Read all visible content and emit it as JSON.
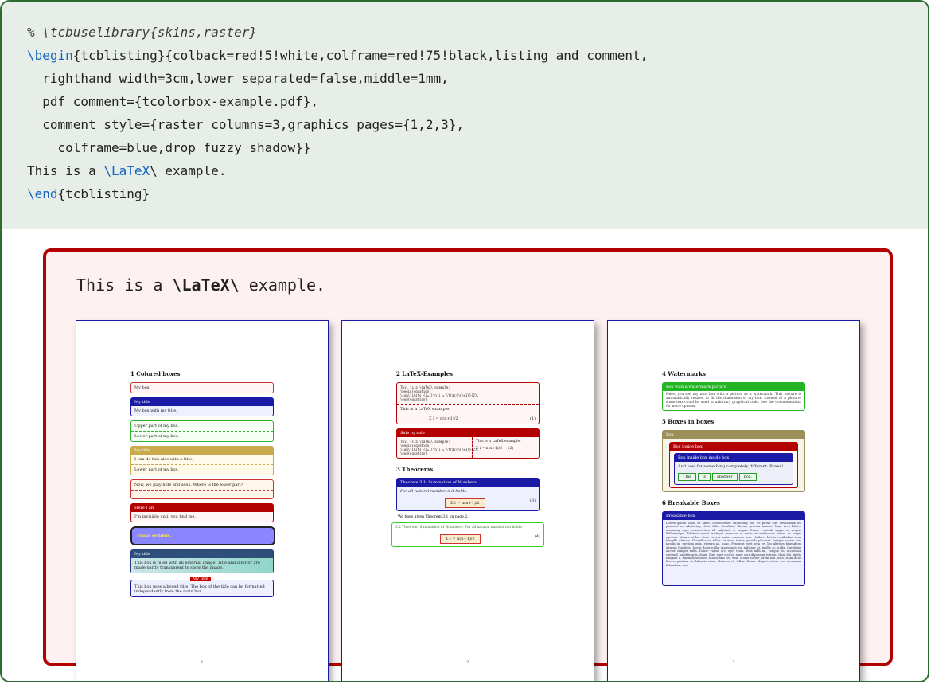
{
  "listing": {
    "lines": [
      "% \\tcbuselibrary{skins,raster}",
      "\\begin{tcblisting}{colback=red!5!white,colframe=red!75!black,listing and comment,",
      "  righthand width=3cm,lower separated=false,middle=1mm,",
      "  pdf comment={tcolorbox-example.pdf},",
      "  comment style={raster columns=3,graphics pages={1,2,3},",
      "    colframe=blue,drop fuzzy shadow}}",
      "This is a \\LaTeX\\ example.",
      "\\end{tcblisting}"
    ]
  },
  "output": {
    "text_pre": "This is a ",
    "text_bold": "\\LaTeX\\",
    "text_post": " example."
  },
  "pages": [
    {
      "section": "1   Colored boxes",
      "boxes": [
        {
          "body": "My box."
        },
        {
          "title": "My title",
          "body": "My box with my title."
        },
        {
          "upper": "Upper part of my box.",
          "lower": "Lower part of my box."
        },
        {
          "title": "My title",
          "upper": "I can do this also with a title.",
          "lower": "Lower part of my box."
        },
        {
          "upper": "Now, we play hide and seek. Where is the lower part?"
        },
        {
          "title": "Here I am",
          "body": "I'm invisible until you find me."
        },
        {
          "body": "Funny settings."
        },
        {
          "title": "My title",
          "body": "This box is filled with an external image. Title and interior are made partly transparent to show the image."
        },
        {
          "title": "My title",
          "body": "This box uses a boxed title. The box of the title can be formatted independently from the main box."
        }
      ],
      "number": "1"
    },
    {
      "section": "2   LaTeX-Examples",
      "code": "This is a \\LaTeX\\ example:\n\\begin{equation}\n\\sum\\limits_{i=1}^n i = \\frac{n(n+1)}{2}.\n\\end{equation}",
      "rendered": "This is a LaTeX example:",
      "formula": "Σ i = n(n+1)/2",
      "eq1": "(1)",
      "sbs_title": "Side by side",
      "eq2": "(2)",
      "section2": "3   Theorems",
      "thm_title": "Theorem 3.1: Summation of Numbers",
      "thm_body": "For all natural number n it holds:",
      "eq3": "(3)",
      "ref_text": "We have given Theorem 3.1 on page 2.",
      "thm2": "3.2 Theorem (Summation of Numbers): For all natural number n it holds:",
      "eq4": "(4)",
      "number": "2"
    },
    {
      "section": "4   Watermarks",
      "wm_title": "Box with a watermark picture",
      "wm_body": "Here, you see my nice box with a picture as a watermark. This picture is automatically resized to fit the dimension of my box. Instead of a picture, some text could be used or arbitrary graphical code. See the documentation for more options.",
      "section2": "5   Boxes in boxes",
      "outer_title": "Box",
      "inner_title": "Box inside box",
      "inner2_title": "Box inside box inside box",
      "inner2_body": "And now for something completely different: Boxes!",
      "chips": [
        "This",
        "is",
        "another",
        "box."
      ],
      "section3": "6   Breakable Boxes",
      "brk_title": "Breakable box",
      "brk_body": "Lorem ipsum dolor sit amet, consectetuer adipiscing elit. Ut purus elit, vestibulum ut, placerat ac, adipiscing vitae, felis. Curabitur dictum gravida mauris. Nam arcu libero, nonummy eget, consectetuer id, vulputate a, magna. Donec vehicula augue eu neque. Pellentesque habitant morbi tristique senectus et netus et malesuada fames ac turpis egestas. Mauris ut leo. Cras viverra metus rhoncus sem. Nulla et lectus vestibulum urna fringilla ultrices. Phasellus eu tellus sit amet tortor gravida placerat. Integer sapien est, iaculis in, pretium quis, viverra ac, nunc. Praesent eget sem vel leo ultrices bibendum. Aenean faucibus. Morbi dolor nulla, malesuada eu, pulvinar at, mollis ac, nulla. Curabitur auctor semper nulla. Donec varius orci eget risus. Duis nibh mi, congue eu, accumsan eleifend, sagittis quis, diam. Duis eget orci sit amet orci dignissim rutrum. Nam dui ligula, fringilla a, euismod sodales, sollicitudin vel, wisi. Morbi auctor lorem non justo. Nam lacus libero, pretium at, lobortis vitae, ultricies et, tellus. Donec aliquet, tortor sed accumsan bibendum, erat",
      "number": "3"
    }
  ]
}
